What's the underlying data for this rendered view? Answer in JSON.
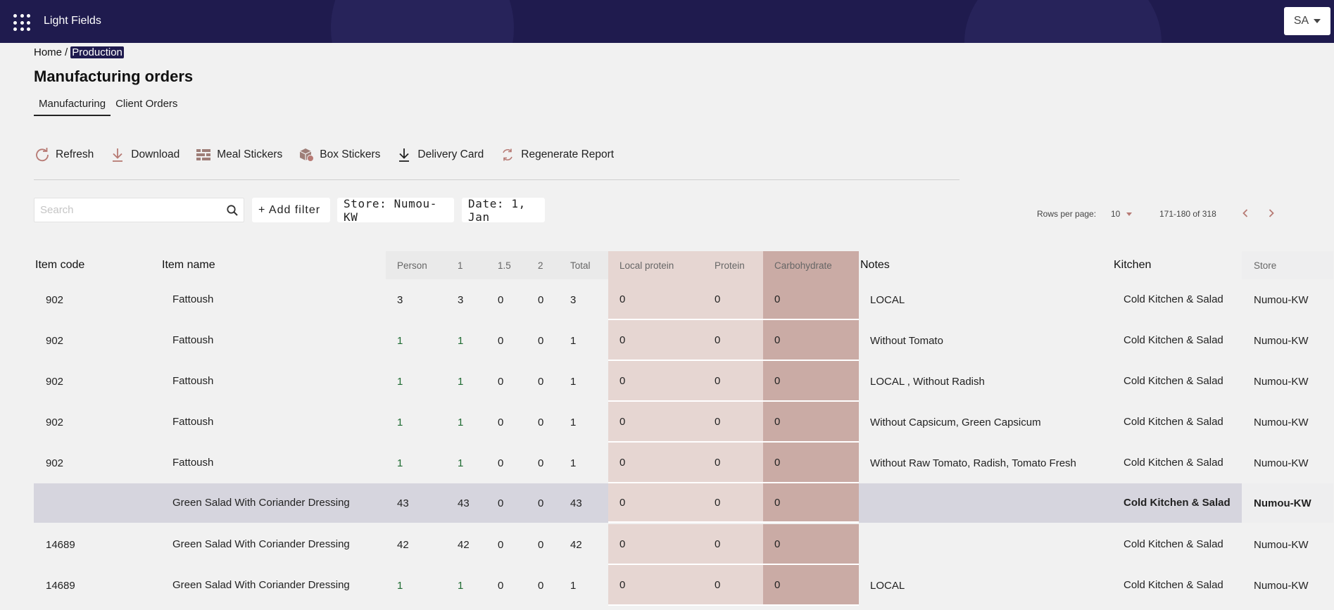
{
  "app": {
    "title": "Light Fields",
    "user_initials": "SA"
  },
  "breadcrumb": {
    "home": "Home",
    "separator": "/",
    "current": "Production"
  },
  "page": {
    "title": "Manufacturing orders"
  },
  "tabs": [
    {
      "label": "Manufacturing",
      "active": true
    },
    {
      "label": "Client Orders",
      "active": false
    }
  ],
  "toolbar": {
    "refresh": "Refresh",
    "download": "Download",
    "meal_stickers": "Meal Stickers",
    "box_stickers": "Box Stickers",
    "delivery_card": "Delivery Card",
    "regenerate_report": "Regenerate Report"
  },
  "filters": {
    "search_placeholder": "Search",
    "add_filter": "+ Add filter",
    "store": "Store: Numou-KW",
    "date": "Date: 1, Jan"
  },
  "pagination": {
    "rows_per_page_label": "Rows per page:",
    "rows_per_page": "10",
    "range": "171-180 of 318"
  },
  "colors": {
    "header_bg": "#1f1b4e",
    "accent": "#b77a74",
    "protein_bg": "#e6d6d2",
    "carb_bg": "#caaba5",
    "group_row_bg": "#d6d5de"
  },
  "table": {
    "headers": {
      "code": "Item code",
      "name": "Item name",
      "person": "Person",
      "one": "1",
      "onefive": "1.5",
      "two": "2",
      "total": "Total",
      "local_protein": "Local protein",
      "protein": "Protein",
      "carbohydrate": "Carbohydrate",
      "notes": "Notes",
      "kitchen": "Kitchen",
      "store": "Store"
    },
    "rows": [
      {
        "code": "902",
        "name": "Fattoush",
        "person": "3",
        "one": "3",
        "onefive": "0",
        "two": "0",
        "total": "3",
        "local_protein": "0",
        "protein": "0",
        "carbohydrate": "0",
        "notes": "LOCAL",
        "kitchen": "Cold Kitchen & Salad",
        "store": "Numou-KW"
      },
      {
        "code": "902",
        "name": "Fattoush",
        "person": "1",
        "one": "1",
        "onefive": "0",
        "two": "0",
        "total": "1",
        "local_protein": "0",
        "protein": "0",
        "carbohydrate": "0",
        "notes": "Without Tomato",
        "kitchen": "Cold Kitchen & Salad",
        "store": "Numou-KW"
      },
      {
        "code": "902",
        "name": "Fattoush",
        "person": "1",
        "one": "1",
        "onefive": "0",
        "two": "0",
        "total": "1",
        "local_protein": "0",
        "protein": "0",
        "carbohydrate": "0",
        "notes": "LOCAL , Without Radish",
        "kitchen": "Cold Kitchen & Salad",
        "store": "Numou-KW"
      },
      {
        "code": "902",
        "name": "Fattoush",
        "person": "1",
        "one": "1",
        "onefive": "0",
        "two": "0",
        "total": "1",
        "local_protein": "0",
        "protein": "0",
        "carbohydrate": "0",
        "notes": "Without Capsicum, Green Capsicum",
        "kitchen": "Cold Kitchen & Salad",
        "store": "Numou-KW"
      },
      {
        "code": "902",
        "name": "Fattoush",
        "person": "1",
        "one": "1",
        "onefive": "0",
        "two": "0",
        "total": "1",
        "local_protein": "0",
        "protein": "0",
        "carbohydrate": "0",
        "notes": "Without Raw Tomato, Radish, Tomato Fresh",
        "kitchen": "Cold Kitchen & Salad",
        "store": "Numou-KW"
      },
      {
        "code": "",
        "name": "Green Salad With Coriander Dressing",
        "person": "43",
        "one": "43",
        "onefive": "0",
        "two": "0",
        "total": "43",
        "local_protein": "0",
        "protein": "0",
        "carbohydrate": "0",
        "notes": "",
        "kitchen": "Cold Kitchen & Salad",
        "store": "Numou-KW",
        "group": true
      },
      {
        "code": "14689",
        "name": "Green Salad With Coriander Dressing",
        "person": "42",
        "one": "42",
        "onefive": "0",
        "two": "0",
        "total": "42",
        "local_protein": "0",
        "protein": "0",
        "carbohydrate": "0",
        "notes": "",
        "kitchen": "Cold Kitchen & Salad",
        "store": "Numou-KW"
      },
      {
        "code": "14689",
        "name": "Green Salad With Coriander Dressing",
        "person": "1",
        "one": "1",
        "onefive": "0",
        "two": "0",
        "total": "1",
        "local_protein": "0",
        "protein": "0",
        "carbohydrate": "0",
        "notes": "LOCAL",
        "kitchen": "Cold Kitchen & Salad",
        "store": "Numou-KW"
      }
    ]
  }
}
